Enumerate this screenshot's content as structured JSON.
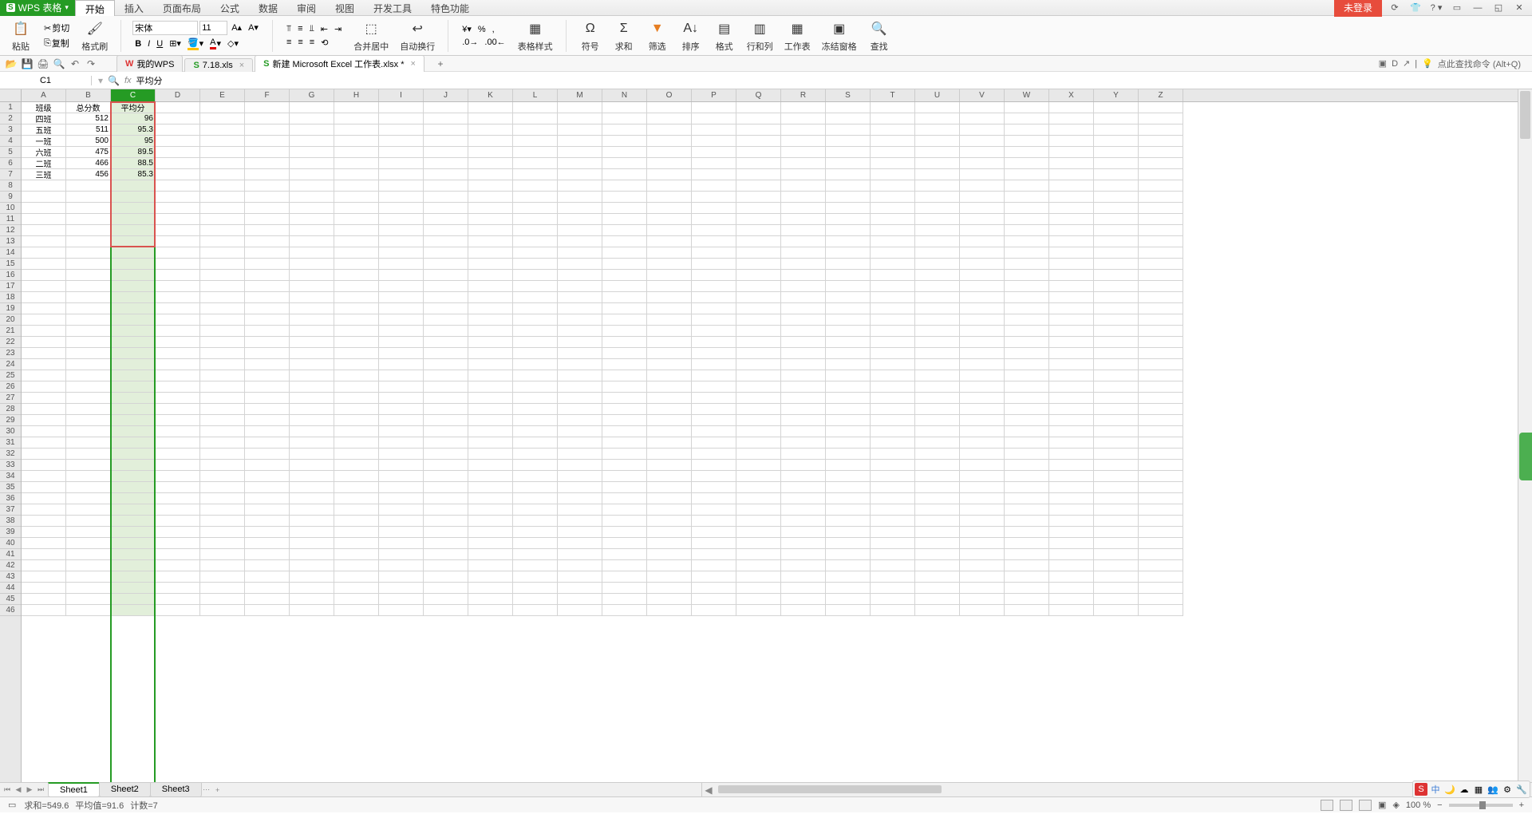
{
  "app": {
    "name": "WPS 表格",
    "notLogged": "未登录"
  },
  "menus": [
    "开始",
    "插入",
    "页面布局",
    "公式",
    "数据",
    "审阅",
    "视图",
    "开发工具",
    "特色功能"
  ],
  "menuActive": 0,
  "ribbon": {
    "paste": "粘贴",
    "cut": "剪切",
    "copy": "复制",
    "formatPainter": "格式刷",
    "font": "宋体",
    "size": "11",
    "bold": "B",
    "italic": "I",
    "underline": "U",
    "mergeCenter": "合并居中",
    "wrap": "自动换行",
    "tableStyle": "表格样式",
    "symbol": "符号",
    "sum": "求和",
    "filter": "筛选",
    "sort": "排序",
    "format": "格式",
    "rowCol": "行和列",
    "worksheet": "工作表",
    "freeze": "冻结窗格",
    "find": "查找"
  },
  "docTabs": [
    {
      "label": "我的WPS",
      "icon": "w",
      "active": false
    },
    {
      "label": "7.18.xls",
      "icon": "s",
      "active": false,
      "closable": true
    },
    {
      "label": "新建 Microsoft Excel 工作表.xlsx *",
      "icon": "s",
      "active": true,
      "closable": true
    }
  ],
  "searchCmd": "点此查找命令 (Alt+Q)",
  "nameBox": "C1",
  "formula": "平均分",
  "columns": [
    "A",
    "B",
    "C",
    "D",
    "E",
    "F",
    "G",
    "H",
    "I",
    "J",
    "K",
    "L",
    "M",
    "N",
    "O",
    "P",
    "Q",
    "R",
    "S",
    "T",
    "U",
    "V",
    "W",
    "X",
    "Y",
    "Z"
  ],
  "rowCount": 46,
  "table": {
    "header": [
      "班级",
      "总分数",
      "平均分"
    ],
    "rows": [
      [
        "四班",
        "512",
        "96"
      ],
      [
        "五班",
        "511",
        "95.3"
      ],
      [
        "一班",
        "500",
        "95"
      ],
      [
        "六班",
        "475",
        "89.5"
      ],
      [
        "二班",
        "466",
        "88.5"
      ],
      [
        "三班",
        "456",
        "85.3"
      ]
    ]
  },
  "selectedColIndex": 2,
  "redBoxRows": 13,
  "sheets": [
    "Sheet1",
    "Sheet2",
    "Sheet3"
  ],
  "activeSheet": 0,
  "status": {
    "sum": "求和=549.6",
    "avg": "平均值=91.6",
    "count": "计数=7",
    "zoom": "100 %"
  },
  "ime": [
    "S",
    "中",
    "🌙",
    "☁",
    "▦",
    "👥",
    "⚙",
    "🔧"
  ]
}
